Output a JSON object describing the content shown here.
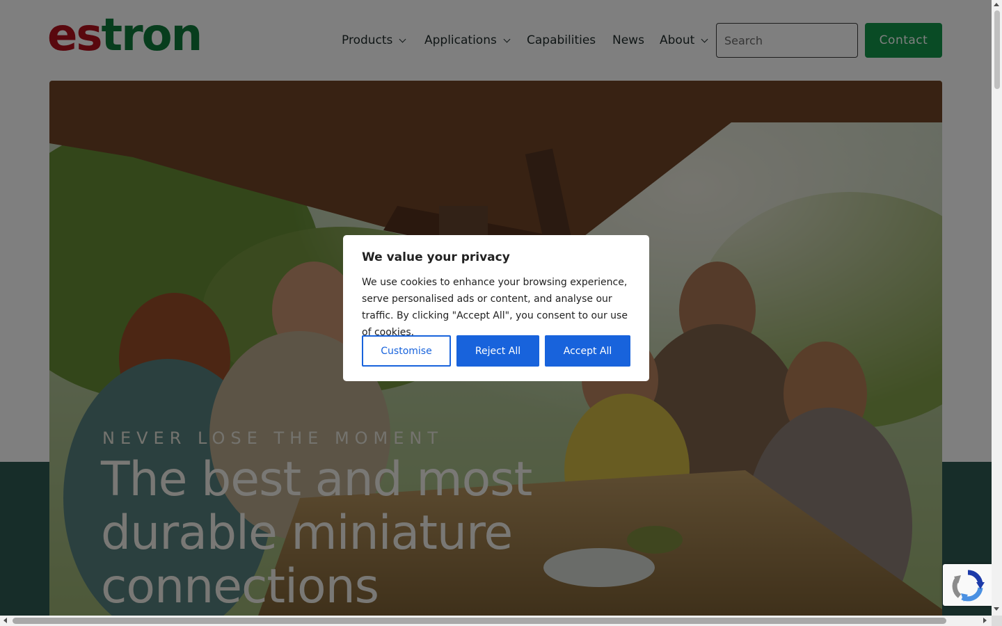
{
  "logo": {
    "part1": "es",
    "part2": "tron"
  },
  "nav": {
    "products": "Products",
    "applications": "Applications",
    "capabilities": "Capabilities",
    "news": "News",
    "about": "About"
  },
  "search": {
    "placeholder": "Search"
  },
  "contact": {
    "label": "Contact"
  },
  "hero": {
    "eyebrow": "NEVER LOSE THE MOMENT",
    "title": "The best and most durable miniature connections"
  },
  "cookie": {
    "title": "We value your privacy",
    "body": "We use cookies to enhance your browsing experience, serve personalised ads or content, and analyse our traffic. By clicking \"Accept All\", you consent to our use of cookies.",
    "customise": "Customise",
    "reject": "Reject All",
    "accept": "Accept All"
  },
  "colors": {
    "logo_red": "#b3101d",
    "logo_green": "#0e7a3a",
    "contact_green": "#13964a",
    "cookie_blue": "#1863dc",
    "band_teal": "#2f5a52"
  },
  "icons": [
    "chevron-down-icon",
    "recaptcha-icon"
  ]
}
